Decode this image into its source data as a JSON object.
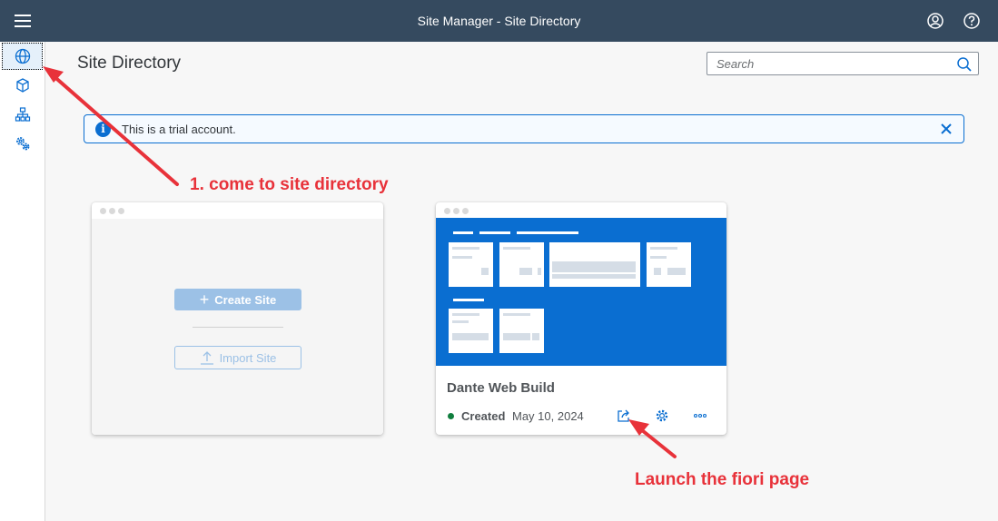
{
  "shell": {
    "title": "Site Manager - Site Directory"
  },
  "sidebar": {
    "items": [
      {
        "name": "site-directory",
        "icon": "globe-icon",
        "active": true
      },
      {
        "name": "content-manager",
        "icon": "cube-icon"
      },
      {
        "name": "provider-manager",
        "icon": "hierarchy-icon"
      },
      {
        "name": "settings",
        "icon": "gears-icon"
      }
    ]
  },
  "page": {
    "title": "Site Directory"
  },
  "search": {
    "placeholder": "Search",
    "value": ""
  },
  "message": {
    "text": "This is a trial account."
  },
  "create_card": {
    "create_label": "Create Site",
    "import_label": "Import Site"
  },
  "site_card": {
    "name": "Dante Web Build",
    "status": "Created",
    "date": "May 10, 2024"
  },
  "annotations": {
    "step1": "1. come to site directory",
    "step2": "Launch the fiori page"
  },
  "colors": {
    "shell": "#354a5f",
    "accent": "#0a6ed1",
    "annotation": "#e8323a",
    "status_created": "#107e3e"
  }
}
